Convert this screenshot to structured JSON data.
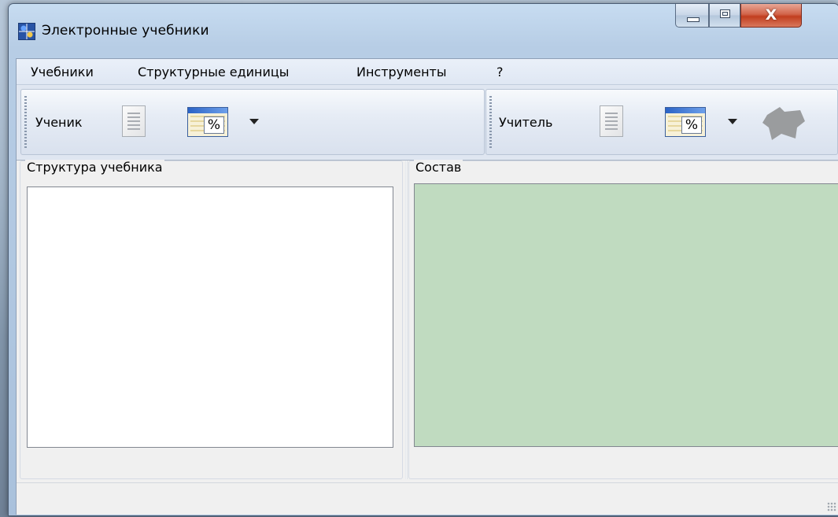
{
  "window": {
    "title": "Электронные учебники",
    "close_symbol": "X"
  },
  "menu": {
    "items": [
      "Учебники",
      "Структурные единицы",
      "Инструменты",
      "?"
    ]
  },
  "toolbar_student": {
    "label": "Ученик",
    "icons": [
      "document-icon",
      "percent-table-icon",
      "dropdown-arrow-icon"
    ],
    "percent_symbol": "%"
  },
  "toolbar_teacher": {
    "label": "Учитель",
    "icons": [
      "document-icon",
      "percent-table-icon",
      "dropdown-arrow-icon",
      "gray-shape-icon"
    ],
    "percent_symbol": "%"
  },
  "panels": {
    "structure_title": "Структура учебника",
    "content_title": "Состав"
  },
  "colors": {
    "content_background": "#c0dbc0",
    "close_button": "#c13e1f"
  }
}
